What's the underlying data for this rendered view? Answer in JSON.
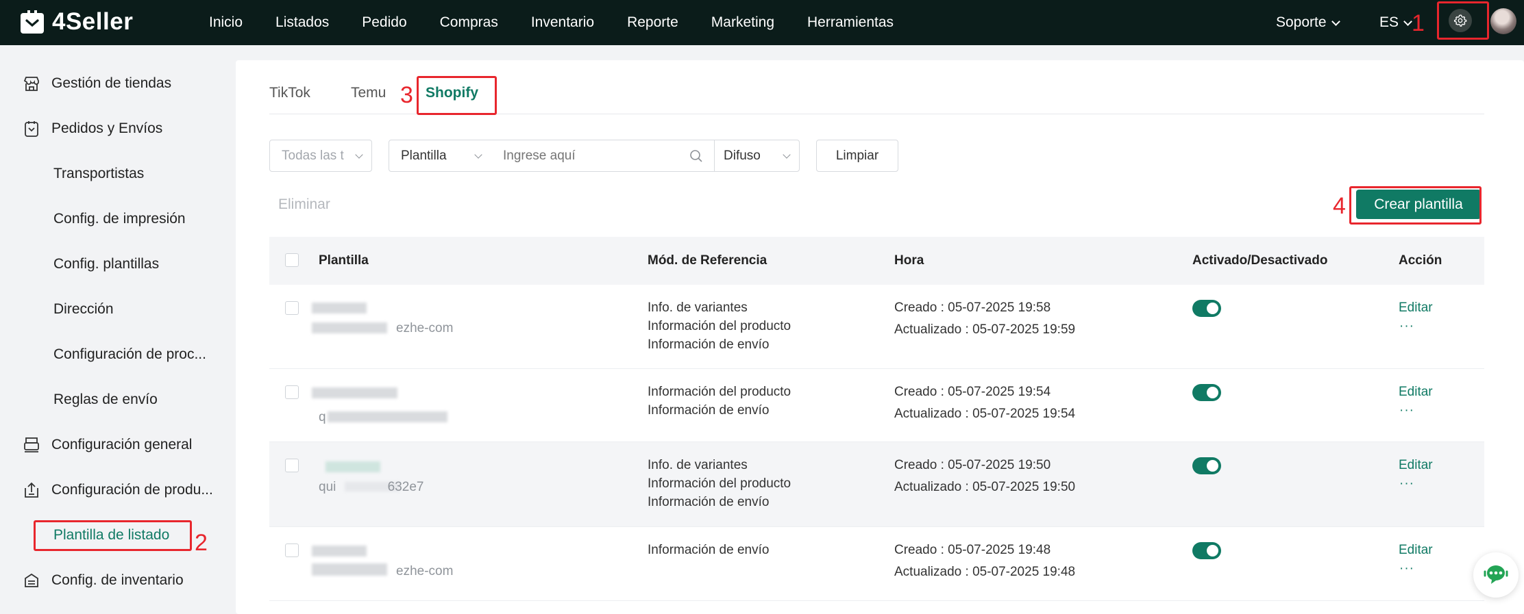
{
  "brand": {
    "name": "4Seller"
  },
  "nav": {
    "items": [
      "Inicio",
      "Listados",
      "Pedido",
      "Compras",
      "Inventario",
      "Reporte",
      "Marketing",
      "Herramientas"
    ],
    "support": "Soporte",
    "language": "ES"
  },
  "sidebar": {
    "items": [
      {
        "label": "Gestión de tiendas",
        "icon": "store-icon"
      },
      {
        "label": "Pedidos y Envíos",
        "icon": "clipboard-icon"
      },
      {
        "label": "Transportistas"
      },
      {
        "label": "Config. de impresión"
      },
      {
        "label": "Config. plantillas"
      },
      {
        "label": "Dirección"
      },
      {
        "label": "Configuración de proc..."
      },
      {
        "label": "Reglas de envío"
      },
      {
        "label": "Configuración general",
        "icon": "printer-icon"
      },
      {
        "label": "Configuración de produ...",
        "icon": "upload-box-icon"
      },
      {
        "label": "Plantilla de listado",
        "active": true
      },
      {
        "label": "Config. de inventario",
        "icon": "layers-icon"
      }
    ]
  },
  "tabs": [
    "TikTok",
    "Temu",
    "Shopify"
  ],
  "active_tab": "Shopify",
  "filters": {
    "store_select": "Todas las t",
    "field_select": "Plantilla",
    "search_placeholder": "Ingrese aquí",
    "match_select": "Difuso",
    "clear_label": "Limpiar"
  },
  "actions": {
    "delete_label": "Eliminar",
    "create_label": "Crear plantilla"
  },
  "table": {
    "headers": [
      "Plantilla",
      "Mód. de Referencia",
      "Hora",
      "Activado/Desactivado",
      "Acción"
    ],
    "rows": [
      {
        "name_visible": "ezhe-com",
        "modules": [
          "Info. de variantes",
          "Información del producto",
          "Información de envío"
        ],
        "created": "Creado : 05-07-2025 19:58",
        "updated": "Actualizado : 05-07-2025 19:59",
        "enabled": true,
        "edit": "Editar",
        "more": "···"
      },
      {
        "name_visible": "q",
        "modules": [
          "Información del producto",
          "Información de envío"
        ],
        "created": "Creado : 05-07-2025 19:54",
        "updated": "Actualizado : 05-07-2025 19:54",
        "enabled": true,
        "edit": "Editar",
        "more": "···"
      },
      {
        "name_visible": "qui 632e7",
        "modules": [
          "Info. de variantes",
          "Información del producto",
          "Información de envío"
        ],
        "created": "Creado : 05-07-2025 19:50",
        "updated": "Actualizado : 05-07-2025 19:50",
        "enabled": true,
        "edit": "Editar",
        "more": "···"
      },
      {
        "name_visible": "ezhe-com",
        "modules": [
          "Información de envío"
        ],
        "created": "Creado : 05-07-2025 19:48",
        "updated": "Actualizado : 05-07-2025 19:48",
        "enabled": true,
        "edit": "Editar",
        "more": "···"
      }
    ]
  },
  "annotations": [
    "1",
    "2",
    "3",
    "4"
  ],
  "colors": {
    "topbar": "#0b1c1a",
    "accent": "#107a64",
    "annotation": "#e8262d"
  }
}
